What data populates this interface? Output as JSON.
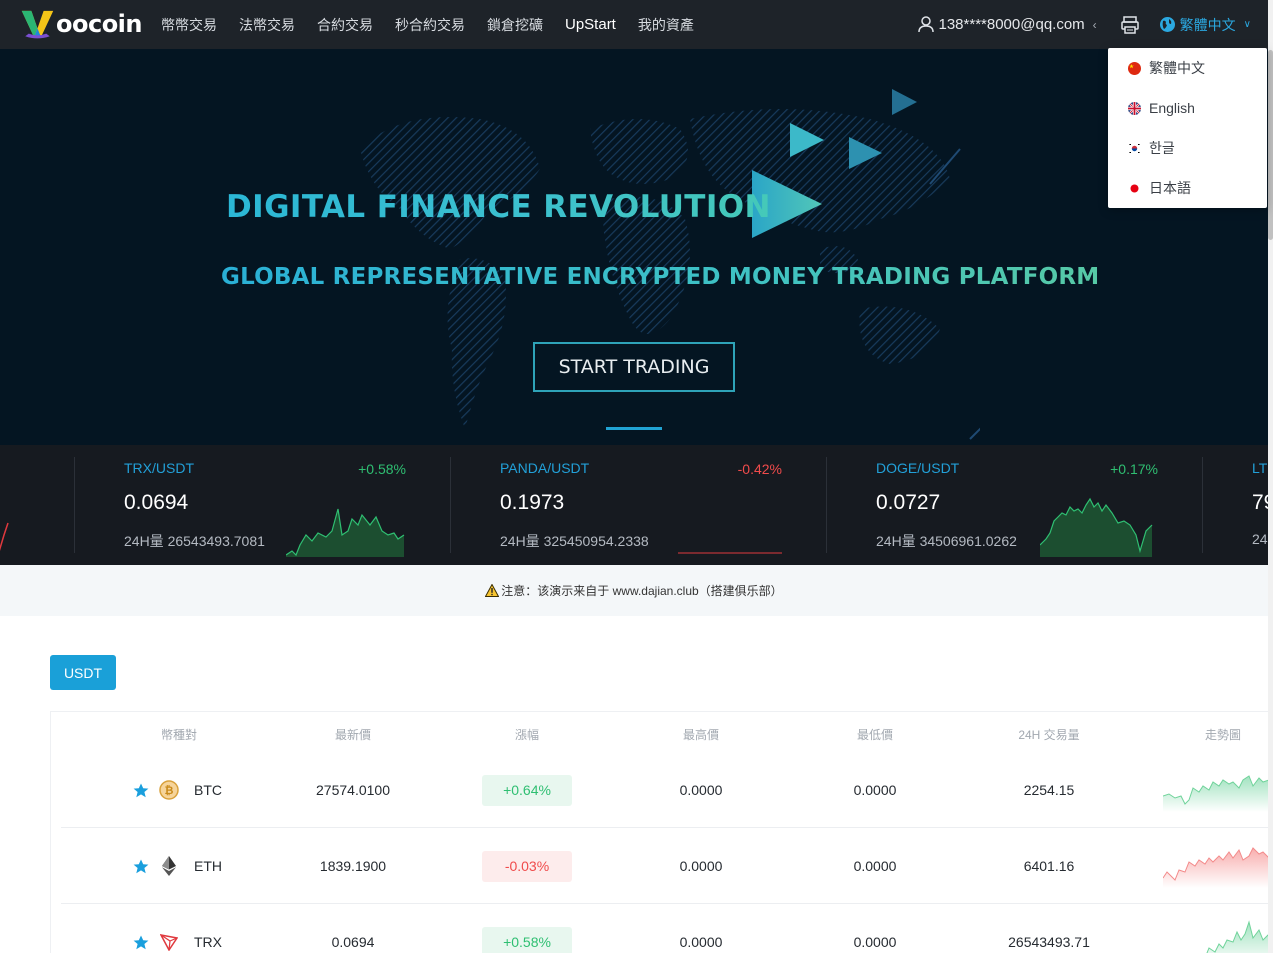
{
  "brand": {
    "name": "oocoin"
  },
  "nav": {
    "items": [
      "幣幣交易",
      "法幣交易",
      "合約交易",
      "秒合約交易",
      "鎖倉挖礦",
      "UpStart",
      "我的資產"
    ],
    "user_email": "138****8000@qq.com",
    "language": "繁體中文"
  },
  "language_menu": {
    "options": [
      "繁體中文",
      "English",
      "한글",
      "日本語"
    ]
  },
  "hero": {
    "title": "DIGITAL FINANCE REVOLUTION",
    "subtitle": "GLOBAL REPRESENTATIVE ENCRYPTED MONEY TRADING PLATFORM",
    "button_label": "START TRADING"
  },
  "ticker": {
    "partial_left_change": "%",
    "cards": [
      {
        "pair": "TRX/USDT",
        "change": "+0.58%",
        "price": "0.0694",
        "volume": "24H量 26543493.7081",
        "trend": "up"
      },
      {
        "pair": "PANDA/USDT",
        "change": "-0.42%",
        "price": "0.1973",
        "volume": "24H量 325450954.2338",
        "trend": "down"
      },
      {
        "pair": "DOGE/USDT",
        "change": "+0.17%",
        "price": "0.0727",
        "volume": "24H量 34506961.0262",
        "trend": "up"
      },
      {
        "pair": "LT",
        "change": "",
        "price": "79",
        "volume": "24",
        "trend": "up"
      }
    ]
  },
  "notice": {
    "text": "注意：该演示来自于 www.dajian.club（搭建俱乐部）"
  },
  "market": {
    "tab_label": "USDT",
    "headers": [
      "幣種對",
      "最新價",
      "漲幅",
      "最高價",
      "最低價",
      "24H 交易量",
      "走勢圖"
    ],
    "rows": [
      {
        "coin": "BTC",
        "last": "27574.0100",
        "change": "+0.64%",
        "high": "0.0000",
        "low": "0.0000",
        "volume": "2254.15",
        "trend": "up"
      },
      {
        "coin": "ETH",
        "last": "1839.1900",
        "change": "-0.03%",
        "high": "0.0000",
        "low": "0.0000",
        "volume": "6401.16",
        "trend": "down"
      },
      {
        "coin": "TRX",
        "last": "0.0694",
        "change": "+0.58%",
        "high": "0.0000",
        "low": "0.0000",
        "volume": "26543493.71",
        "trend": "up"
      }
    ]
  },
  "colors": {
    "accent": "#1aa0d8",
    "up": "#2fbf72",
    "down": "#f04b4b",
    "nav_bg": "#1e2329",
    "hero_bg": "#041522",
    "ticker_bg": "#161a20"
  }
}
